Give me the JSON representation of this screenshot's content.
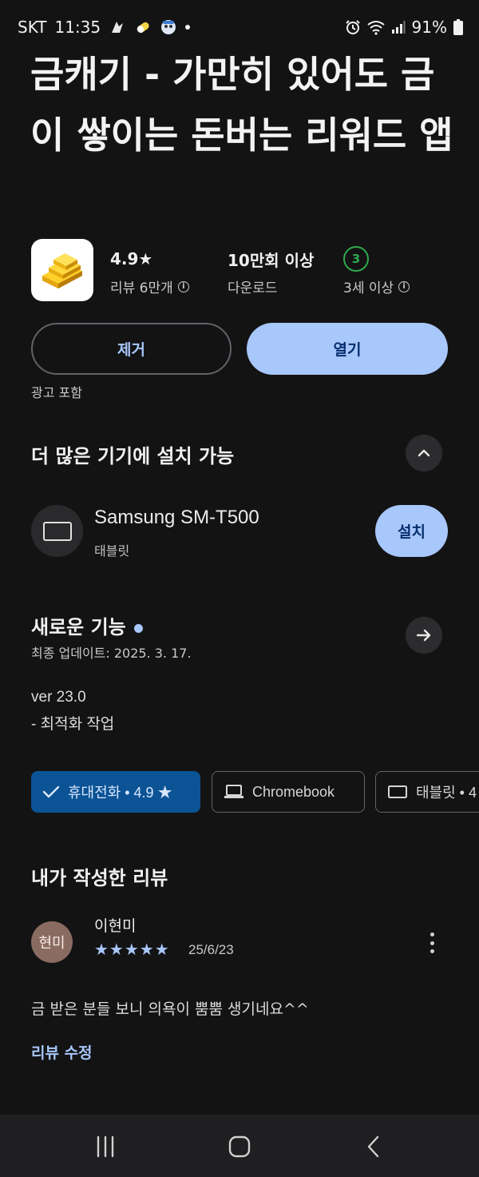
{
  "status_bar": {
    "carrier": "SKT",
    "time": "11:35",
    "battery": "91%"
  },
  "app": {
    "title": "금캐기 - 가만히 있어도 금이 쌓이는 돈버는 리워드 앱",
    "rating": "4.9★",
    "reviews": "리뷰 6만개",
    "downloads": "10만회 이상",
    "downloads_label": "다운로드",
    "age_badge": "3",
    "age_label": "3세 이상"
  },
  "actions": {
    "remove_label": "제거",
    "open_label": "열기",
    "ads_label": "광고 포함"
  },
  "more_devices": {
    "title": "더 많은 기기에 설치 가능",
    "device_name": "Samsung SM-T500",
    "device_type": "태블릿",
    "install_label": "설치"
  },
  "whats_new": {
    "title": "새로운 기능",
    "last_update": "최종 업데이트: 2025. 3. 17.",
    "notes": [
      "ver 23.0",
      "- 최적화 작업"
    ]
  },
  "device_chips": [
    {
      "label": "휴대전화 • 4.9 ★",
      "selected": true
    },
    {
      "label": "Chromebook",
      "selected": false
    },
    {
      "label": "태블릿 • 4",
      "selected": false
    }
  ],
  "my_review": {
    "title": "내가 작성한 리뷰",
    "avatar_text": "현미",
    "reviewer": "이현미",
    "stars": "★★★★★",
    "date": "25/6/23",
    "text": "금 받은 분들 보니 의욕이 뿜뿜 생기네요^^",
    "edit_label": "리뷰 수정"
  },
  "colors": {
    "background": "#131314",
    "accent": "#a8c7fa",
    "chip_selected": "#0b5394",
    "age_green": "#2fa94e"
  }
}
